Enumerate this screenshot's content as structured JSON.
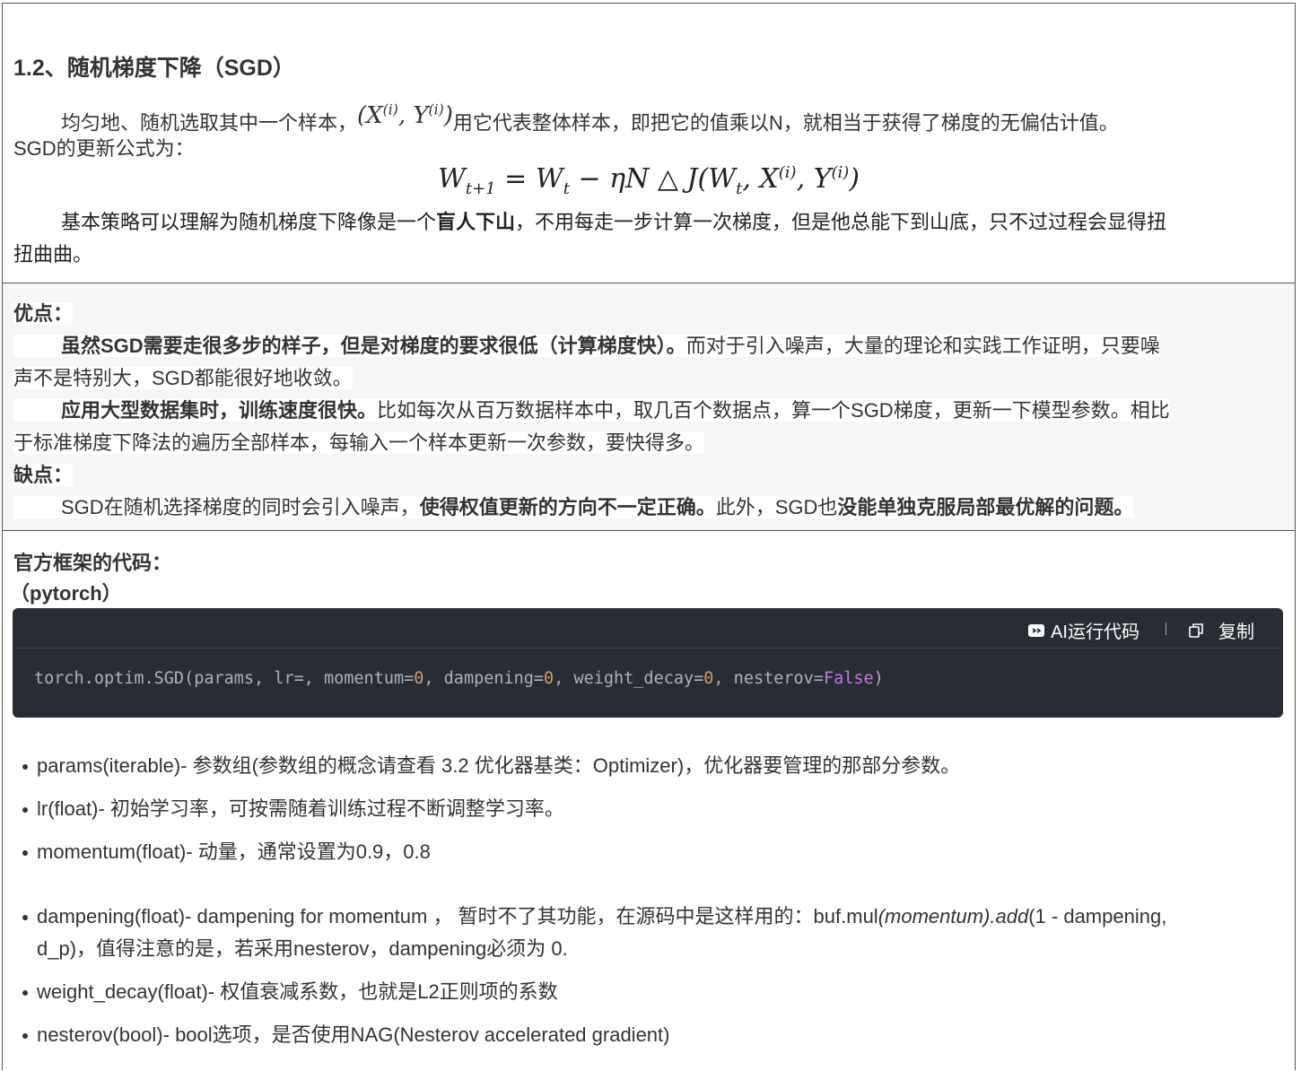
{
  "section1": {
    "heading": "1.2、随机梯度下降（SGD）",
    "para1_a": "均匀地、随机选取其中一个样本，",
    "para1_math": "(X^(i), Y^(i))",
    "para1_b": "用它代表整体样本，即把它的值乘以N，就相当于获得了梯度的无偏估计值。",
    "para1_c": "SGD的更新公式为：",
    "formula": "W_{t+1} = W_t − ηN △ J(W_t, X^(i), Y^(i))",
    "para2_a": "基本策略可以理解为随机梯度下降像是一个",
    "para2_bold": "盲人下山",
    "para2_b": "，不用每走一步计算一次梯度，但是他总能下到山底，只不过过程会显得扭",
    "para2_c": "扭曲曲。"
  },
  "section2": {
    "pros_label": "优点：",
    "pro1_bold": "虽然SGD需要走很多步的样子，但是对梯度的要求很低（计算梯度快）。",
    "pro1_rest": "而对于引入噪声，大量的理论和实践工作证明，只要噪",
    "pro1_cont": "声不是特别大，SGD都能很好地收敛。",
    "pro2_bold": "应用大型数据集时，训练速度很快。",
    "pro2_rest": "比如每次从百万数据样本中，取几百个数据点，算一个SGD梯度，更新一下模型参数。相比",
    "pro2_cont": "于标准梯度下降法的遍历全部样本，每输入一个样本更新一次参数，要快得多。",
    "cons_label": "缺点：",
    "con1_a": "SGD在随机选择梯度的同时会引入噪声，",
    "con1_bold1": "使得权值更新的方向不一定正确。",
    "con1_b": "此外，SGD也",
    "con1_bold2": "没能单独克服局部最优解的问题。"
  },
  "section3": {
    "heading": "官方框架的代码：",
    "sub": "（pytorch）",
    "code_toolbar": {
      "run_label": "AI运行代码",
      "copy_label": "复制"
    },
    "code": {
      "p1": "torch.optim.SGD(params, lr=, momentum=",
      "n1": "0",
      "p2": ", dampening=",
      "n2": "0",
      "p3": ", weight_decay=",
      "n3": "0",
      "p4": ", nesterov=",
      "kw": "False",
      "p5": ")"
    },
    "params": [
      "params(iterable)- 参数组(参数组的概念请查看 3.2 优化器基类：Optimizer)，优化器要管理的那部分参数。",
      "lr(float)- 初始学习率，可按需随着训练过程不断调整学习率。",
      "momentum(float)- 动量，通常设置为0.9，0.8",
      "dampening(float)- dampening for momentum ， 暂时不了其功能，在源码中是这样用的：buf.mul",
      "weight_decay(float)- 权值衰减系数，也就是L2正则项的系数",
      "nesterov(bool)- bool选项，是否使用NAG(Nesterov accelerated gradient)"
    ],
    "dampening_italic": "(momentum).add",
    "dampening_tail": "(1 - dampening,",
    "dampening_line2": "d_p)，值得注意的是，若采用nesterov，dampening必须为 0."
  }
}
